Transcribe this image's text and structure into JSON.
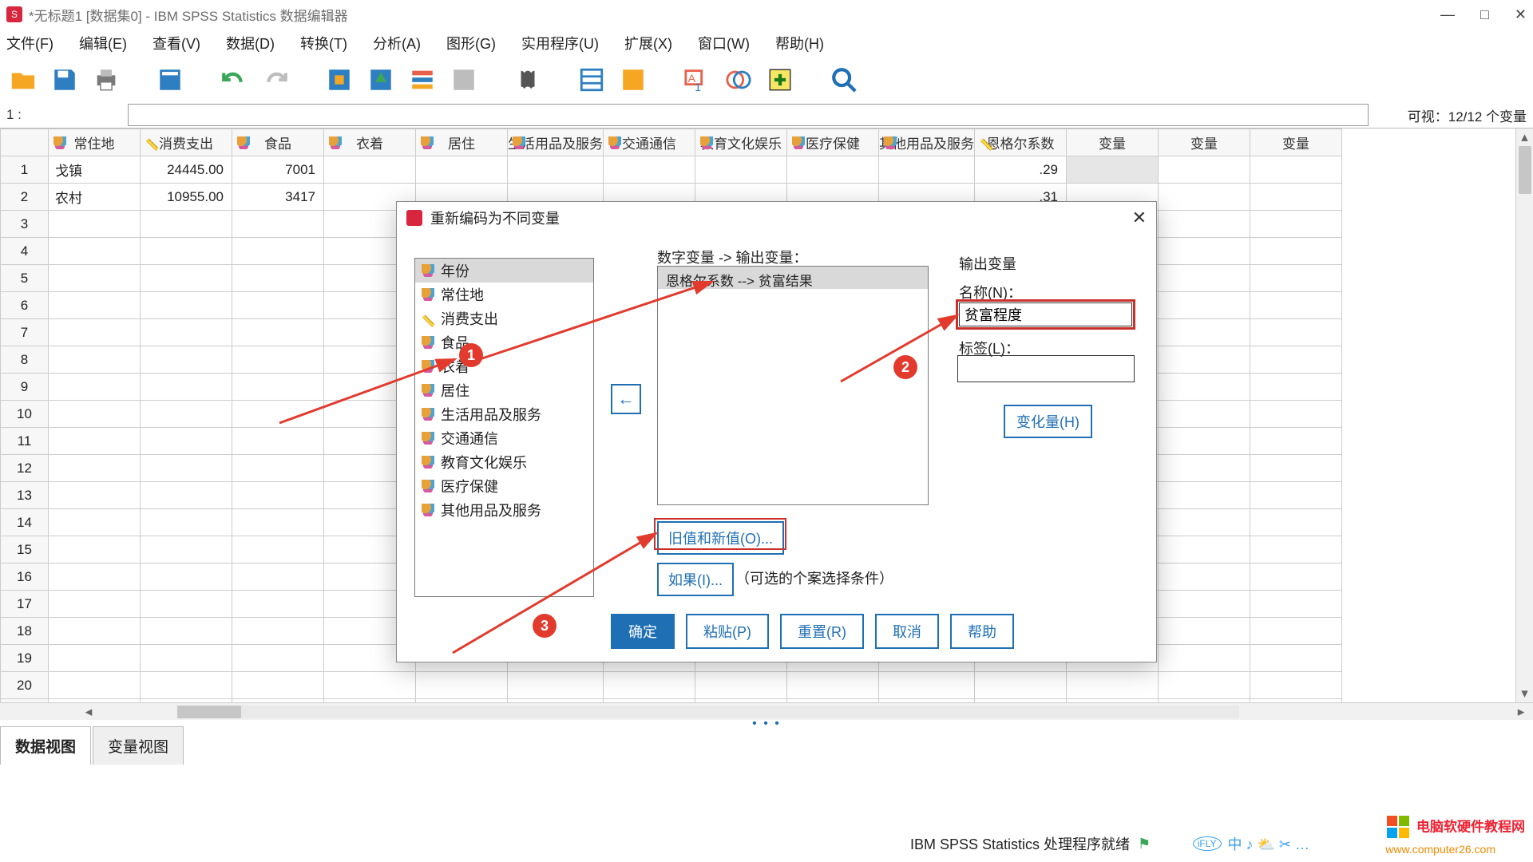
{
  "title": "*无标题1 [数据集0] - IBM SPSS Statistics 数据编辑器",
  "menus": [
    "文件(F)",
    "编辑(E)",
    "查看(V)",
    "数据(D)",
    "转换(T)",
    "分析(A)",
    "图形(G)",
    "实用程序(U)",
    "扩展(X)",
    "窗口(W)",
    "帮助(H)"
  ],
  "indicator": {
    "label": "1 :",
    "visible": "可视：12/12 个变量"
  },
  "columns": [
    "常住地",
    "消费支出",
    "食品",
    "衣着",
    "居住",
    "生活用品及服务",
    "交通通信",
    "教育文化娱乐",
    "医疗保健",
    "其他用品及服务",
    "恩格尔系数",
    "变量",
    "变量",
    "变量"
  ],
  "col_icons": [
    "nom",
    "scale",
    "nom",
    "nom",
    "nom",
    "nom",
    "nom",
    "nom",
    "nom",
    "nom",
    "scale",
    "",
    "",
    ""
  ],
  "rows": [
    {
      "n": 1,
      "c0": "戈镇",
      "c1": "24445.00",
      "c2": "7001",
      "c10": ".29"
    },
    {
      "n": 2,
      "c0": "农村",
      "c1": "10955.00",
      "c2": "3417",
      "c10": ".31"
    }
  ],
  "extra_row_count": 20,
  "tabs": {
    "data": "数据视图",
    "var": "变量视图"
  },
  "status": "IBM SPSS Statistics 处理程序就绪",
  "dialog": {
    "title": "重新编码为不同变量",
    "varlist": [
      {
        "label": "年份",
        "icon": "nom",
        "sel": true
      },
      {
        "label": "常住地",
        "icon": "str"
      },
      {
        "label": "消费支出",
        "icon": "scale"
      },
      {
        "label": "食品",
        "icon": "nom"
      },
      {
        "label": "衣着",
        "icon": "nom"
      },
      {
        "label": "居住",
        "icon": "nom"
      },
      {
        "label": "生活用品及服务",
        "icon": "nom"
      },
      {
        "label": "交通通信",
        "icon": "nom"
      },
      {
        "label": "教育文化娱乐",
        "icon": "nom"
      },
      {
        "label": "医疗保健",
        "icon": "nom"
      },
      {
        "label": "其他用品及服务",
        "icon": "nom"
      }
    ],
    "map_label": "数字变量 -> 输出变量：",
    "map_item": "恩格尔系数 --> 贫富结果",
    "out_header": "输出变量",
    "name_label": "名称(N)：",
    "name_value": "贫富程度",
    "tag_label": "标签(L)：",
    "change": "变化量(H)",
    "oldnew": "旧值和新值(O)...",
    "ifbtn": "如果(I)...",
    "ifnote": "（可选的个案选择条件）",
    "buttons": {
      "ok": "确定",
      "paste": "粘贴(P)",
      "reset": "重置(R)",
      "cancel": "取消",
      "help": "帮助"
    }
  },
  "badges": {
    "b1": "1",
    "b2": "2",
    "b3": "3"
  },
  "ime": "中 ♪ ⛅ ✂ …",
  "watermark": {
    "l1": "电脑软硬件教程网",
    "l2": "www.computer26.com"
  }
}
